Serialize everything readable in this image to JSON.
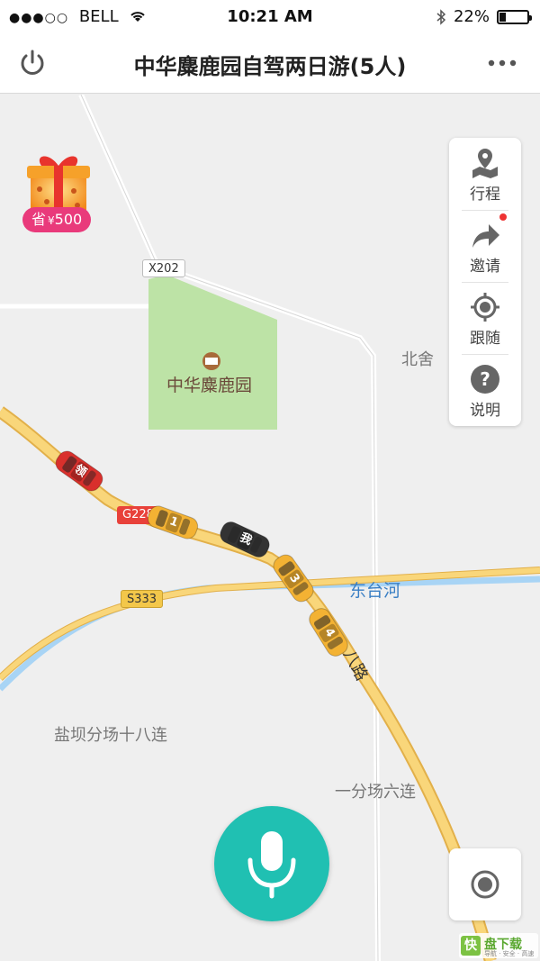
{
  "status_bar": {
    "signal_dots": "●●●○○",
    "carrier": "BELL",
    "time": "10:21 AM",
    "battery_text": "22%",
    "battery_level": 0.22
  },
  "header": {
    "title": "中华麋鹿园自驾两日游(5人)",
    "power_icon": "power-icon",
    "more_icon": "more-icon"
  },
  "gift": {
    "icon": "gift-box-icon",
    "save_label": "省",
    "currency": "¥",
    "amount": "500"
  },
  "side_panel": {
    "items": [
      {
        "label": "行程",
        "icon": "map-pin-icon"
      },
      {
        "label": "邀请",
        "icon": "share-arrow-icon"
      },
      {
        "label": "跟随",
        "icon": "follow-target-icon"
      },
      {
        "label": "说明",
        "icon": "help-icon"
      }
    ],
    "invite_has_notification": true
  },
  "map": {
    "poi": "中华麋鹿园",
    "labels": {
      "beishe": "北舍",
      "river": "东台河",
      "road_suffix": "八路",
      "yanba": "盐坝分场十八连",
      "yifen": "一分场六连"
    },
    "road_badges": {
      "x202": "X202",
      "g228": "G228",
      "s333": "S333"
    },
    "cars": [
      {
        "label": "1",
        "color": "#f3b233"
      },
      {
        "label": "我",
        "color": "#333333"
      },
      {
        "label": "3",
        "color": "#f3b233"
      },
      {
        "label": "4",
        "color": "#f3b233"
      },
      {
        "label": "领",
        "color": "#d9302c"
      }
    ],
    "colors": {
      "park": "#bde3a6",
      "road_yellow": "#f9d67a",
      "road_edge": "#e2b04a",
      "river": "#a8d4f5"
    }
  },
  "controls": {
    "mic_icon": "microphone-icon",
    "locate_icon": "locate-icon"
  },
  "watermark": {
    "logo_text": "快",
    "name": "盘下载",
    "slogan": "导航 · 安全 · 高速"
  }
}
